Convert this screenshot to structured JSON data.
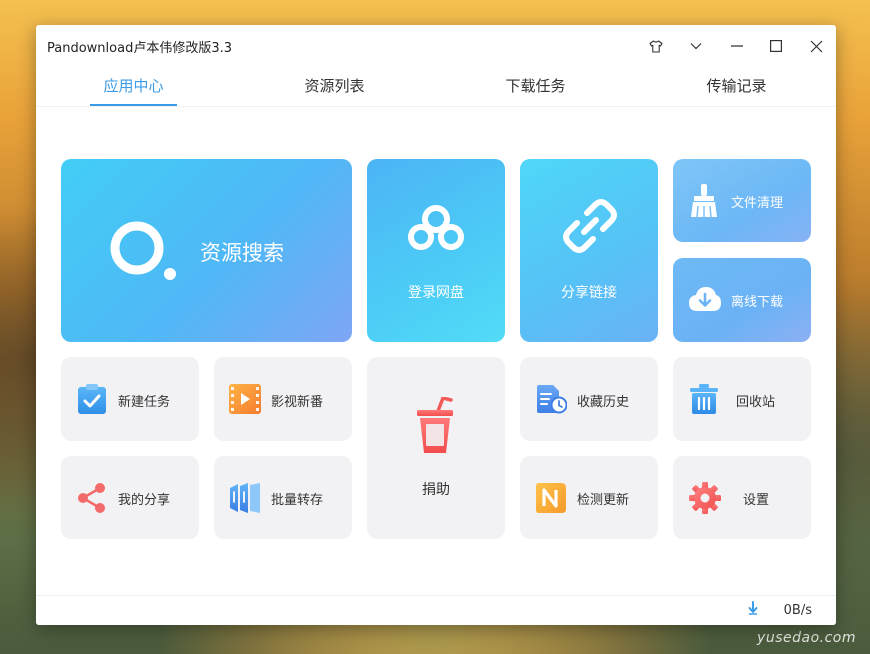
{
  "window": {
    "title": "Pandownload卢本伟修改版3.3"
  },
  "tabs": [
    {
      "label": "应用中心",
      "active": true
    },
    {
      "label": "资源列表",
      "active": false
    },
    {
      "label": "下载任务",
      "active": false
    },
    {
      "label": "传输记录",
      "active": false
    }
  ],
  "tiles": {
    "search": "资源搜索",
    "login": "登录网盘",
    "share_link": "分享链接",
    "file_clean": "文件清理",
    "offline": "离线下载",
    "new_task": "新建任务",
    "video": "影视新番",
    "donate": "捐助",
    "history": "收藏历史",
    "recycle": "回收站",
    "my_share": "我的分享",
    "batch": "批量转存",
    "update": "检测更新",
    "settings": "设置"
  },
  "status": {
    "speed": "0B/s"
  },
  "watermark": "yusedao.com",
  "colors": {
    "accent": "#3b9be6",
    "tile_gray": "#f2f2f4"
  }
}
